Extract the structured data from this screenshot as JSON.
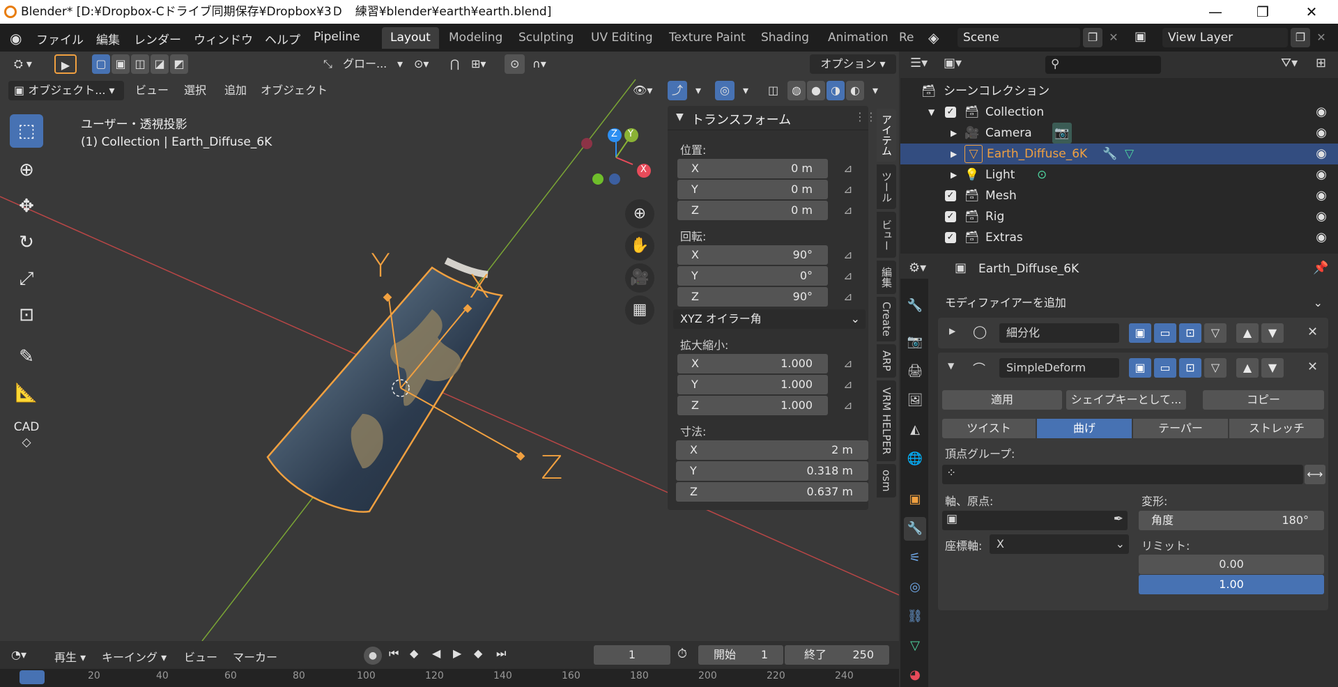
{
  "titlebar": {
    "title": "Blender* [D:¥Dropbox-Cドライブ同期保存¥Dropbox¥3Ｄ　練習¥blender¥earth¥earth.blend]",
    "minimize": "—",
    "restore": "❐",
    "close": "✕"
  },
  "menu": {
    "items": [
      "ファイル",
      "編集",
      "レンダー",
      "ウィンドウ",
      "ヘルプ",
      "Pipeline"
    ]
  },
  "workspaces": [
    "Layout",
    "Modeling",
    "Sculpting",
    "UV Editing",
    "Texture Paint",
    "Shading",
    "Animation",
    "Re"
  ],
  "scene": {
    "name": "Scene",
    "view_layer": "View Layer"
  },
  "toolbar": {
    "orientation": "グロー...",
    "options": "オプション"
  },
  "viewport_header": {
    "mode": "オブジェクト...",
    "view": "ビュー",
    "select": "選択",
    "add": "追加",
    "object": "オブジェクト"
  },
  "viewport": {
    "projection": "ユーザー・透視投影",
    "info": "(1) Collection | Earth_Diffuse_6K",
    "axis_labels": {
      "x": "X",
      "y": "Y",
      "z": "Z"
    }
  },
  "tools": [
    "select",
    "cursor",
    "move",
    "rotate",
    "scale",
    "transform",
    "annotate",
    "measure",
    "cad"
  ],
  "tools_text": {
    "cad": "CAD"
  },
  "npanel": {
    "title": "トランスフォーム",
    "location_label": "位置:",
    "location": [
      {
        "axis": "X",
        "value": "0 m"
      },
      {
        "axis": "Y",
        "value": "0 m"
      },
      {
        "axis": "Z",
        "value": "0 m"
      }
    ],
    "rotation_label": "回転:",
    "rotation": [
      {
        "axis": "X",
        "value": "90°"
      },
      {
        "axis": "Y",
        "value": "0°"
      },
      {
        "axis": "Z",
        "value": "90°"
      }
    ],
    "rotation_mode": "XYZ オイラー角",
    "scale_label": "拡大縮小:",
    "scale": [
      {
        "axis": "X",
        "value": "1.000"
      },
      {
        "axis": "Y",
        "value": "1.000"
      },
      {
        "axis": "Z",
        "value": "1.000"
      }
    ],
    "dimensions_label": "寸法:",
    "dimensions": [
      {
        "axis": "X",
        "value": "2 m"
      },
      {
        "axis": "Y",
        "value": "0.318 m"
      },
      {
        "axis": "Z",
        "value": "0.637 m"
      }
    ]
  },
  "vtabs": [
    "アイテム",
    "ツール",
    "ビュー",
    "編集",
    "Create",
    "ARP",
    "VRM HELPER",
    "osm"
  ],
  "outliner": {
    "root": "シーンコレクション",
    "rows": [
      {
        "name": "Collection"
      },
      {
        "name": "Camera"
      },
      {
        "name": "Earth_Diffuse_6K"
      },
      {
        "name": "Light"
      },
      {
        "name": "Mesh"
      },
      {
        "name": "Rig"
      },
      {
        "name": "Extras"
      }
    ]
  },
  "properties": {
    "object_name": "Earth_Diffuse_6K",
    "add_modifier": "モディファイアーを追加",
    "mod1": {
      "name": "細分化"
    },
    "mod2": {
      "name": "SimpleDeform"
    },
    "apply": "適用",
    "shape_key": "シェイプキーとして...",
    "copy": "コピー",
    "modes": [
      "ツイスト",
      "曲げ",
      "テーパー",
      "ストレッチ"
    ],
    "vertex_group_label": "頂点グループ:",
    "axis_origin_label": "軸、原点:",
    "deform_label": "変形:",
    "angle_label": "角度",
    "angle_value": "180°",
    "coord_axis_label": "座標軸:",
    "coord_axis_value": "X",
    "limits_label": "リミット:",
    "limit_min": "0.00",
    "limit_max": "1.00"
  },
  "timeline": {
    "play": "再生",
    "keying": "キーイング",
    "view": "ビュー",
    "marker": "マーカー",
    "current_frame": "1",
    "start_label": "開始",
    "start": "1",
    "end_label": "終了",
    "end": "250",
    "ruler": [
      "20",
      "40",
      "60",
      "80",
      "100",
      "120",
      "140",
      "160",
      "180",
      "200",
      "220",
      "240"
    ]
  },
  "colors": {
    "accent": "#4772b3",
    "selected_row": "#334d80",
    "x_axis": "#c84848",
    "y_axis": "#8ab235",
    "object_outline": "#f0a040"
  }
}
